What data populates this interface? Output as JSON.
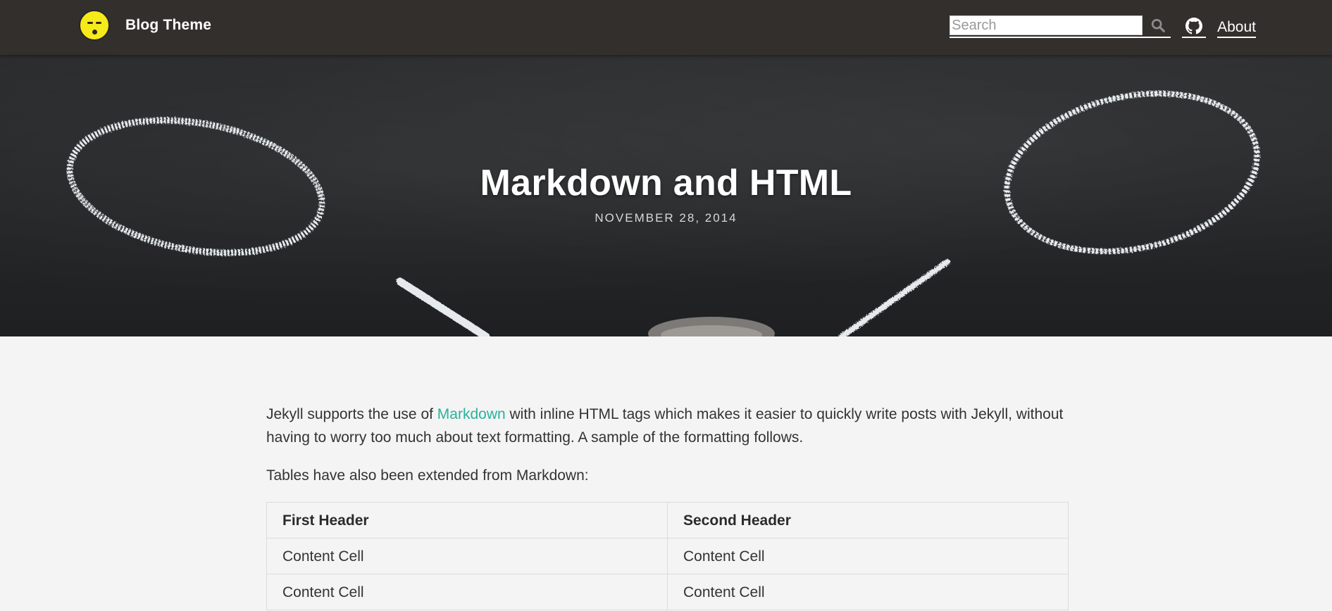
{
  "header": {
    "brand_title": "Blog Theme",
    "logo_icon": "emoji-face-icon",
    "search": {
      "placeholder": "Search",
      "value": ""
    },
    "search_icon": "search-icon",
    "github_icon": "github-icon",
    "about_label": "About"
  },
  "hero": {
    "title": "Markdown and HTML",
    "date": "NOVEMBER 28, 2014"
  },
  "post": {
    "intro_before_link": "Jekyll supports the use of ",
    "intro_link": "Markdown",
    "intro_after_link": " with inline HTML tags which makes it easier to quickly write posts with Jekyll, without having to worry too much about text formatting. A sample of the formatting follows.",
    "tables_intro": "Tables have also been extended from Markdown:",
    "table": {
      "headers": [
        "First Header",
        "Second Header"
      ],
      "rows": [
        [
          "Content Cell",
          "Content Cell"
        ],
        [
          "Content Cell",
          "Content Cell"
        ]
      ]
    }
  },
  "colors": {
    "navbar": "#332f2c",
    "page_background": "#f4f4f4",
    "link": "#2ab29b",
    "logo_yellow": "#f7ea1a"
  }
}
